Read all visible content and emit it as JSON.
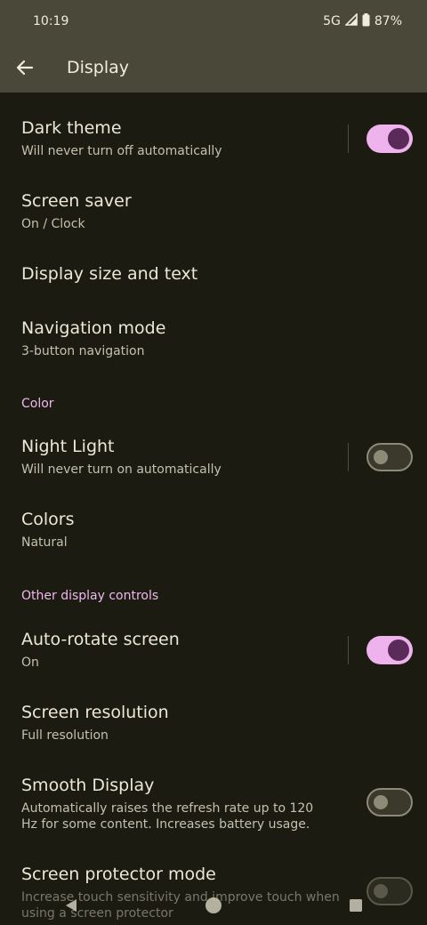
{
  "status": {
    "time": "10:19",
    "network": "5G",
    "battery": "87%"
  },
  "app_bar": {
    "title": "Display"
  },
  "items": {
    "dark_theme": {
      "title": "Dark theme",
      "summary": "Will never turn off automatically",
      "checked": true
    },
    "screen_saver": {
      "title": "Screen saver",
      "summary": "On / Clock"
    },
    "display_size": {
      "title": "Display size and text"
    },
    "navigation_mode": {
      "title": "Navigation mode",
      "summary": "3-button navigation"
    },
    "color_header": "Color",
    "night_light": {
      "title": "Night Light",
      "summary": "Will never turn on automatically",
      "checked": false
    },
    "colors": {
      "title": "Colors",
      "summary": "Natural"
    },
    "other_header": "Other display controls",
    "auto_rotate": {
      "title": "Auto-rotate screen",
      "summary": "On",
      "checked": true
    },
    "screen_resolution": {
      "title": "Screen resolution",
      "summary": "Full resolution"
    },
    "smooth_display": {
      "title": "Smooth Display",
      "summary": "Automatically raises the refresh rate up to 120 Hz for some content. Increases battery usage.",
      "checked": false
    },
    "screen_protector": {
      "title": "Screen protector mode",
      "summary": "Increase touch sensitivity and improve touch when using a screen protector",
      "checked": false
    }
  },
  "icons": {
    "back": "arrow-left",
    "nav_back": "triangle-left",
    "nav_home": "circle",
    "nav_recents": "square"
  },
  "colors": {
    "background": "#1c1b12",
    "app_bar": "#4a4839",
    "accent": "#eeb3ec",
    "accent_thumb": "#5a2a58",
    "section_header": "#efb8f0"
  }
}
